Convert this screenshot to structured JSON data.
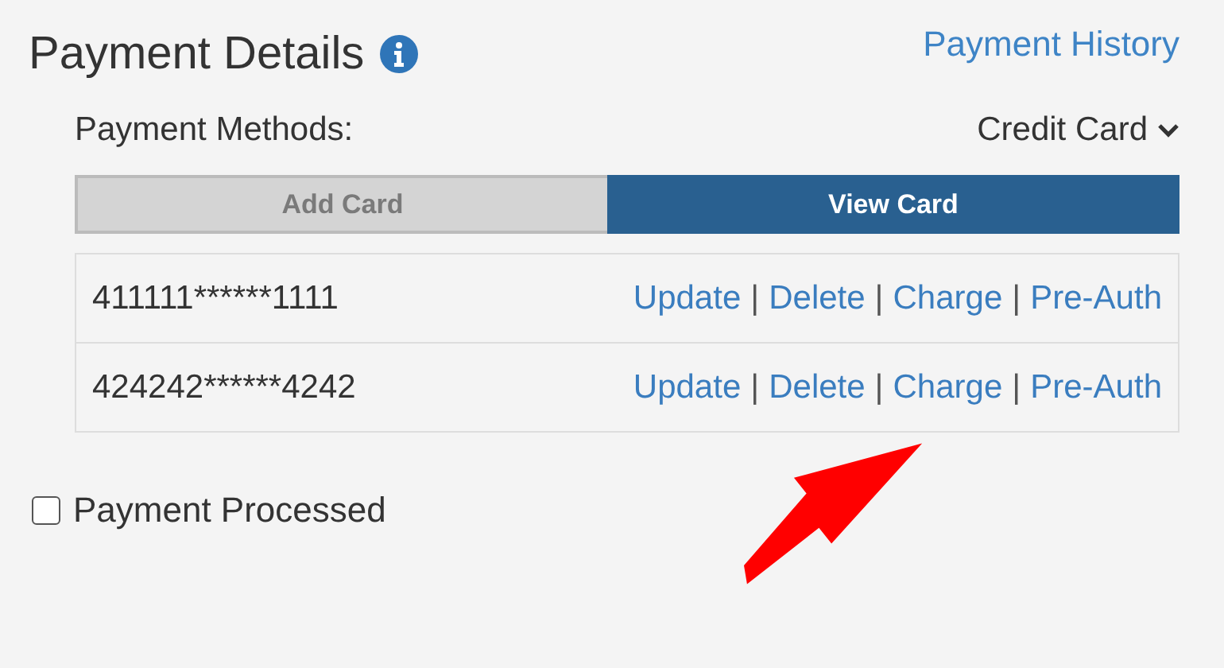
{
  "header": {
    "title": "Payment Details",
    "history_link": "Payment History"
  },
  "methods": {
    "label": "Payment Methods:",
    "value": "Credit Card"
  },
  "tabs": [
    {
      "label": "Add Card",
      "selected": false
    },
    {
      "label": "View Card",
      "selected": true
    }
  ],
  "cards": [
    {
      "number": "411111******1111",
      "actions": [
        {
          "kind": "link",
          "text": "Update"
        },
        {
          "kind": "separator",
          "text": "|"
        },
        {
          "kind": "link",
          "text": "Delete"
        },
        {
          "kind": "separator",
          "text": "|"
        },
        {
          "kind": "link",
          "text": "Charge"
        },
        {
          "kind": "separator",
          "text": "|"
        },
        {
          "kind": "link",
          "text": "Pre-Auth"
        }
      ]
    },
    {
      "number": "424242******4242",
      "actions": [
        {
          "kind": "link",
          "text": "Update"
        },
        {
          "kind": "separator",
          "text": "|"
        },
        {
          "kind": "link",
          "text": "Delete"
        },
        {
          "kind": "separator",
          "text": "|"
        },
        {
          "kind": "link",
          "text": "Charge"
        },
        {
          "kind": "separator",
          "text": "|"
        },
        {
          "kind": "link",
          "text": "Pre-Auth"
        }
      ]
    }
  ],
  "processed": {
    "label": "Payment Processed",
    "checked": false
  },
  "overlay": {
    "kind": "arrow"
  }
}
